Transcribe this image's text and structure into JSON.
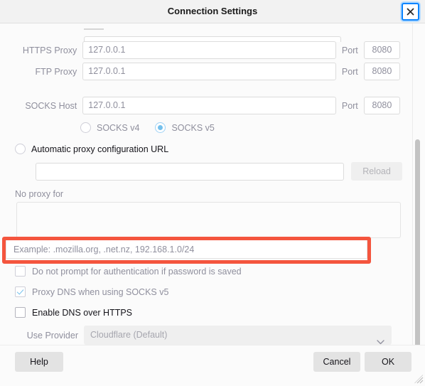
{
  "window": {
    "title": "Connection Settings",
    "close_icon": "close-icon"
  },
  "proxy_fields": [
    {
      "label": "HTTPS Proxy",
      "value": "127.0.0.1",
      "port_label": "Port",
      "port_value": "8080"
    },
    {
      "label": "FTP Proxy",
      "value": "127.0.0.1",
      "port_label": "Port",
      "port_value": "8080"
    },
    {
      "label": "SOCKS Host",
      "value": "127.0.0.1",
      "port_label": "Port",
      "port_value": "8080"
    }
  ],
  "socks_version": {
    "options": [
      {
        "label": "SOCKS v4",
        "selected": false
      },
      {
        "label": "SOCKS v5",
        "selected": true
      }
    ]
  },
  "auto_config": {
    "radio_label": "Automatic proxy configuration URL",
    "url_value": "",
    "reload_label": "Reload"
  },
  "no_proxy": {
    "label": "No proxy for",
    "value": "",
    "example": "Example: .mozilla.org, .net.nz, 192.168.1.0/24"
  },
  "checkboxes": [
    {
      "label": "Do not prompt for authentication if password is saved",
      "checked": false,
      "enabled": false
    },
    {
      "label": "Proxy DNS when using SOCKS v5",
      "checked": true,
      "enabled": false
    },
    {
      "label": "Enable DNS over HTTPS",
      "checked": false,
      "enabled": true
    }
  ],
  "provider": {
    "label": "Use Provider",
    "value": "Cloudflare (Default)",
    "chevron_icon": "chevron-down-icon"
  },
  "footer": {
    "help_label": "Help",
    "cancel_label": "Cancel",
    "ok_label": "OK"
  },
  "colors": {
    "highlight": "#f4553e",
    "accent": "#0a84ff",
    "checked": "#74c0ec"
  }
}
